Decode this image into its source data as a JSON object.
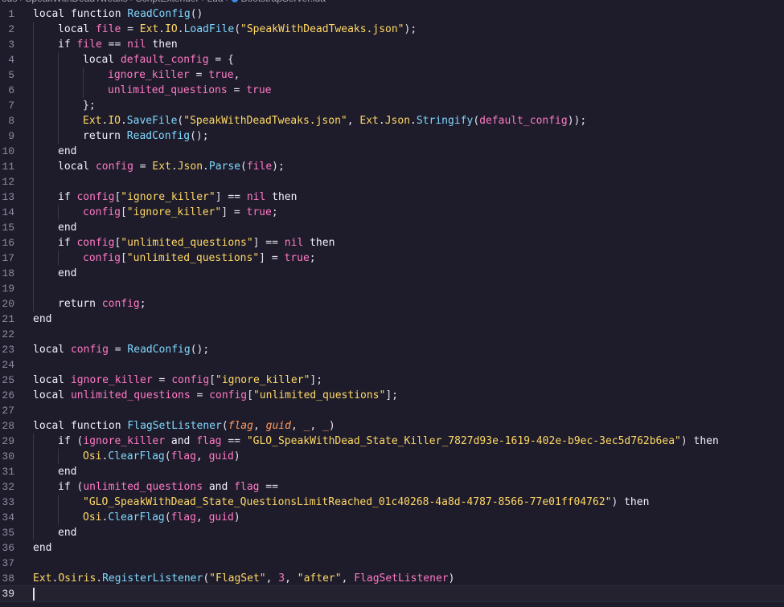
{
  "breadcrumb": {
    "items": [
      "ods",
      "SpeakWithDeadTweaks",
      "ScriptExtender",
      "Lua",
      "BootstrapServer.lua"
    ]
  },
  "editor": {
    "active_line": 39,
    "lines": [
      {
        "n": "1",
        "indent": 0,
        "tokens": [
          [
            "kw",
            "local "
          ],
          [
            "kw",
            "function "
          ],
          [
            "fn",
            "ReadConfig"
          ],
          [
            "pun",
            "()"
          ]
        ]
      },
      {
        "n": "2",
        "indent": 1,
        "tokens": [
          [
            "kw",
            "local "
          ],
          [
            "var",
            "file"
          ],
          [
            "op",
            " = "
          ],
          [
            "ns",
            "Ext"
          ],
          [
            "pun",
            "."
          ],
          [
            "ns",
            "IO"
          ],
          [
            "pun",
            "."
          ],
          [
            "fn",
            "LoadFile"
          ],
          [
            "pun",
            "("
          ],
          [
            "str",
            "\"SpeakWithDeadTweaks.json\""
          ],
          [
            "pun",
            ");"
          ]
        ]
      },
      {
        "n": "3",
        "indent": 1,
        "tokens": [
          [
            "kw",
            "if "
          ],
          [
            "var",
            "file"
          ],
          [
            "op",
            " == "
          ],
          [
            "var",
            "nil"
          ],
          [
            "kw",
            " then"
          ]
        ]
      },
      {
        "n": "4",
        "indent": 2,
        "tokens": [
          [
            "kw",
            "local "
          ],
          [
            "var",
            "default_config"
          ],
          [
            "op",
            " = "
          ],
          [
            "pun",
            "{"
          ]
        ]
      },
      {
        "n": "5",
        "indent": 3,
        "tokens": [
          [
            "var",
            "ignore_killer"
          ],
          [
            "op",
            " = "
          ],
          [
            "num",
            "true"
          ],
          [
            "pun",
            ","
          ]
        ]
      },
      {
        "n": "6",
        "indent": 3,
        "tokens": [
          [
            "var",
            "unlimited_questions"
          ],
          [
            "op",
            " = "
          ],
          [
            "num",
            "true"
          ]
        ]
      },
      {
        "n": "7",
        "indent": 2,
        "tokens": [
          [
            "pun",
            "};"
          ]
        ]
      },
      {
        "n": "8",
        "indent": 2,
        "tokens": [
          [
            "ns",
            "Ext"
          ],
          [
            "pun",
            "."
          ],
          [
            "ns",
            "IO"
          ],
          [
            "pun",
            "."
          ],
          [
            "fn",
            "SaveFile"
          ],
          [
            "pun",
            "("
          ],
          [
            "str",
            "\"SpeakWithDeadTweaks.json\""
          ],
          [
            "pun",
            ", "
          ],
          [
            "ns",
            "Ext"
          ],
          [
            "pun",
            "."
          ],
          [
            "ns",
            "Json"
          ],
          [
            "pun",
            "."
          ],
          [
            "fn",
            "Stringify"
          ],
          [
            "pun",
            "("
          ],
          [
            "var",
            "default_config"
          ],
          [
            "pun",
            "));"
          ]
        ]
      },
      {
        "n": "9",
        "indent": 2,
        "tokens": [
          [
            "kw",
            "return "
          ],
          [
            "fn",
            "ReadConfig"
          ],
          [
            "pun",
            "();"
          ]
        ]
      },
      {
        "n": "10",
        "indent": 1,
        "tokens": [
          [
            "kw",
            "end"
          ]
        ]
      },
      {
        "n": "11",
        "indent": 1,
        "tokens": [
          [
            "kw",
            "local "
          ],
          [
            "var",
            "config"
          ],
          [
            "op",
            " = "
          ],
          [
            "ns",
            "Ext"
          ],
          [
            "pun",
            "."
          ],
          [
            "ns",
            "Json"
          ],
          [
            "pun",
            "."
          ],
          [
            "fn",
            "Parse"
          ],
          [
            "pun",
            "("
          ],
          [
            "var",
            "file"
          ],
          [
            "pun",
            ");"
          ]
        ]
      },
      {
        "n": "12",
        "indent": 1,
        "tokens": []
      },
      {
        "n": "13",
        "indent": 1,
        "tokens": [
          [
            "kw",
            "if "
          ],
          [
            "var",
            "config"
          ],
          [
            "pun",
            "["
          ],
          [
            "str",
            "\"ignore_killer\""
          ],
          [
            "pun",
            "]"
          ],
          [
            "op",
            " == "
          ],
          [
            "var",
            "nil"
          ],
          [
            "kw",
            " then"
          ]
        ]
      },
      {
        "n": "14",
        "indent": 2,
        "tokens": [
          [
            "var",
            "config"
          ],
          [
            "pun",
            "["
          ],
          [
            "str",
            "\"ignore_killer\""
          ],
          [
            "pun",
            "]"
          ],
          [
            "op",
            " = "
          ],
          [
            "num",
            "true"
          ],
          [
            "pun",
            ";"
          ]
        ]
      },
      {
        "n": "15",
        "indent": 1,
        "tokens": [
          [
            "kw",
            "end"
          ]
        ]
      },
      {
        "n": "16",
        "indent": 1,
        "tokens": [
          [
            "kw",
            "if "
          ],
          [
            "var",
            "config"
          ],
          [
            "pun",
            "["
          ],
          [
            "str",
            "\"unlimited_questions\""
          ],
          [
            "pun",
            "]"
          ],
          [
            "op",
            " == "
          ],
          [
            "var",
            "nil"
          ],
          [
            "kw",
            " then"
          ]
        ]
      },
      {
        "n": "17",
        "indent": 2,
        "tokens": [
          [
            "var",
            "config"
          ],
          [
            "pun",
            "["
          ],
          [
            "str",
            "\"unlimited_questions\""
          ],
          [
            "pun",
            "]"
          ],
          [
            "op",
            " = "
          ],
          [
            "num",
            "true"
          ],
          [
            "pun",
            ";"
          ]
        ]
      },
      {
        "n": "18",
        "indent": 1,
        "tokens": [
          [
            "kw",
            "end"
          ]
        ]
      },
      {
        "n": "19",
        "indent": 1,
        "tokens": []
      },
      {
        "n": "20",
        "indent": 1,
        "tokens": [
          [
            "kw",
            "return "
          ],
          [
            "var",
            "config"
          ],
          [
            "pun",
            ";"
          ]
        ]
      },
      {
        "n": "21",
        "indent": 0,
        "tokens": [
          [
            "kw",
            "end"
          ]
        ]
      },
      {
        "n": "22",
        "indent": 0,
        "tokens": []
      },
      {
        "n": "23",
        "indent": 0,
        "tokens": [
          [
            "kw",
            "local "
          ],
          [
            "var",
            "config"
          ],
          [
            "op",
            " = "
          ],
          [
            "fn",
            "ReadConfig"
          ],
          [
            "pun",
            "();"
          ]
        ]
      },
      {
        "n": "24",
        "indent": 0,
        "tokens": []
      },
      {
        "n": "25",
        "indent": 0,
        "tokens": [
          [
            "kw",
            "local "
          ],
          [
            "var",
            "ignore_killer"
          ],
          [
            "op",
            " = "
          ],
          [
            "var",
            "config"
          ],
          [
            "pun",
            "["
          ],
          [
            "str",
            "\"ignore_killer\""
          ],
          [
            "pun",
            "];"
          ]
        ]
      },
      {
        "n": "26",
        "indent": 0,
        "tokens": [
          [
            "kw",
            "local "
          ],
          [
            "var",
            "unlimited_questions"
          ],
          [
            "op",
            " = "
          ],
          [
            "var",
            "config"
          ],
          [
            "pun",
            "["
          ],
          [
            "str",
            "\"unlimited_questions\""
          ],
          [
            "pun",
            "];"
          ]
        ]
      },
      {
        "n": "27",
        "indent": 0,
        "tokens": []
      },
      {
        "n": "28",
        "indent": 0,
        "tokens": [
          [
            "kw",
            "local "
          ],
          [
            "kw",
            "function "
          ],
          [
            "fn",
            "FlagSetListener"
          ],
          [
            "pun",
            "("
          ],
          [
            "prm",
            "flag"
          ],
          [
            "pun",
            ", "
          ],
          [
            "prm",
            "guid"
          ],
          [
            "pun",
            ", "
          ],
          [
            "prm",
            "_"
          ],
          [
            "pun",
            ", "
          ],
          [
            "prm",
            "_"
          ],
          [
            "pun",
            ")"
          ]
        ]
      },
      {
        "n": "29",
        "indent": 1,
        "tokens": [
          [
            "kw",
            "if "
          ],
          [
            "pun",
            "("
          ],
          [
            "var",
            "ignore_killer"
          ],
          [
            "kw",
            " and "
          ],
          [
            "var",
            "flag"
          ],
          [
            "op",
            " == "
          ],
          [
            "str",
            "\"GLO_SpeakWithDead_State_Killer_7827d93e-1619-402e-b9ec-3ec5d762b6ea\""
          ],
          [
            "pun",
            ")"
          ],
          [
            "kw",
            " then"
          ]
        ]
      },
      {
        "n": "30",
        "indent": 2,
        "tokens": [
          [
            "ns",
            "Osi"
          ],
          [
            "pun",
            "."
          ],
          [
            "fn",
            "ClearFlag"
          ],
          [
            "pun",
            "("
          ],
          [
            "var",
            "flag"
          ],
          [
            "pun",
            ", "
          ],
          [
            "var",
            "guid"
          ],
          [
            "pun",
            ")"
          ]
        ]
      },
      {
        "n": "31",
        "indent": 1,
        "tokens": [
          [
            "kw",
            "end"
          ]
        ]
      },
      {
        "n": "32",
        "indent": 1,
        "tokens": [
          [
            "kw",
            "if "
          ],
          [
            "pun",
            "("
          ],
          [
            "var",
            "unlimited_questions"
          ],
          [
            "kw",
            " and "
          ],
          [
            "var",
            "flag"
          ],
          [
            "op",
            " =="
          ]
        ]
      },
      {
        "n": "33",
        "indent": 2,
        "tokens": [
          [
            "str",
            "\"GLO_SpeakWithDead_State_QuestionsLimitReached_01c40268-4a8d-4787-8566-77e01ff04762\""
          ],
          [
            "pun",
            ")"
          ],
          [
            "kw",
            " then"
          ]
        ]
      },
      {
        "n": "34",
        "indent": 2,
        "tokens": [
          [
            "ns",
            "Osi"
          ],
          [
            "pun",
            "."
          ],
          [
            "fn",
            "ClearFlag"
          ],
          [
            "pun",
            "("
          ],
          [
            "var",
            "flag"
          ],
          [
            "pun",
            ", "
          ],
          [
            "var",
            "guid"
          ],
          [
            "pun",
            ")"
          ]
        ]
      },
      {
        "n": "35",
        "indent": 1,
        "tokens": [
          [
            "kw",
            "end"
          ]
        ]
      },
      {
        "n": "36",
        "indent": 0,
        "tokens": [
          [
            "kw",
            "end"
          ]
        ]
      },
      {
        "n": "37",
        "indent": 0,
        "tokens": []
      },
      {
        "n": "38",
        "indent": 0,
        "tokens": [
          [
            "ns",
            "Ext"
          ],
          [
            "pun",
            "."
          ],
          [
            "ns",
            "Osiris"
          ],
          [
            "pun",
            "."
          ],
          [
            "fn",
            "RegisterListener"
          ],
          [
            "pun",
            "("
          ],
          [
            "str",
            "\"FlagSet\""
          ],
          [
            "pun",
            ", "
          ],
          [
            "num",
            "3"
          ],
          [
            "pun",
            ", "
          ],
          [
            "str",
            "\"after\""
          ],
          [
            "pun",
            ", "
          ],
          [
            "var",
            "FlagSetListener"
          ],
          [
            "pun",
            ")"
          ]
        ]
      },
      {
        "n": "39",
        "indent": 0,
        "tokens": []
      }
    ]
  },
  "colors": {
    "background": "#1e1c2a",
    "keyword": "#f2f0ff",
    "function": "#7fd8ff",
    "variable": "#ff79c6",
    "string": "#ffd866",
    "parameter": "#ff9b60"
  }
}
